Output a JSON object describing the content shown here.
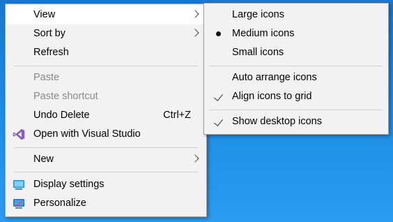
{
  "main_menu": {
    "view": "View",
    "sort_by": "Sort by",
    "refresh": "Refresh",
    "paste": "Paste",
    "paste_shortcut": "Paste shortcut",
    "undo_delete": "Undo Delete",
    "undo_shortcut": "Ctrl+Z",
    "open_with_vs": "Open with Visual Studio",
    "new": "New",
    "display_settings": "Display settings",
    "personalize": "Personalize"
  },
  "view_submenu": {
    "large_icons": "Large icons",
    "medium_icons": "Medium icons",
    "small_icons": "Small icons",
    "auto_arrange": "Auto arrange icons",
    "align_to_grid": "Align icons to grid",
    "show_desktop_icons": "Show desktop icons",
    "selected_size": "Medium icons",
    "auto_arrange_checked": false,
    "align_to_grid_checked": true,
    "show_desktop_icons_checked": true
  },
  "icons": {
    "visual_studio": "visual-studio-icon",
    "display_settings": "display-settings-icon",
    "personalize": "personalize-icon"
  },
  "colors": {
    "desktop": "#1f86dc",
    "menu_bg": "#f2f2f2",
    "highlight": "#ffffff",
    "disabled_text": "#8a8a8a",
    "vs_purple": "#865fc5"
  }
}
